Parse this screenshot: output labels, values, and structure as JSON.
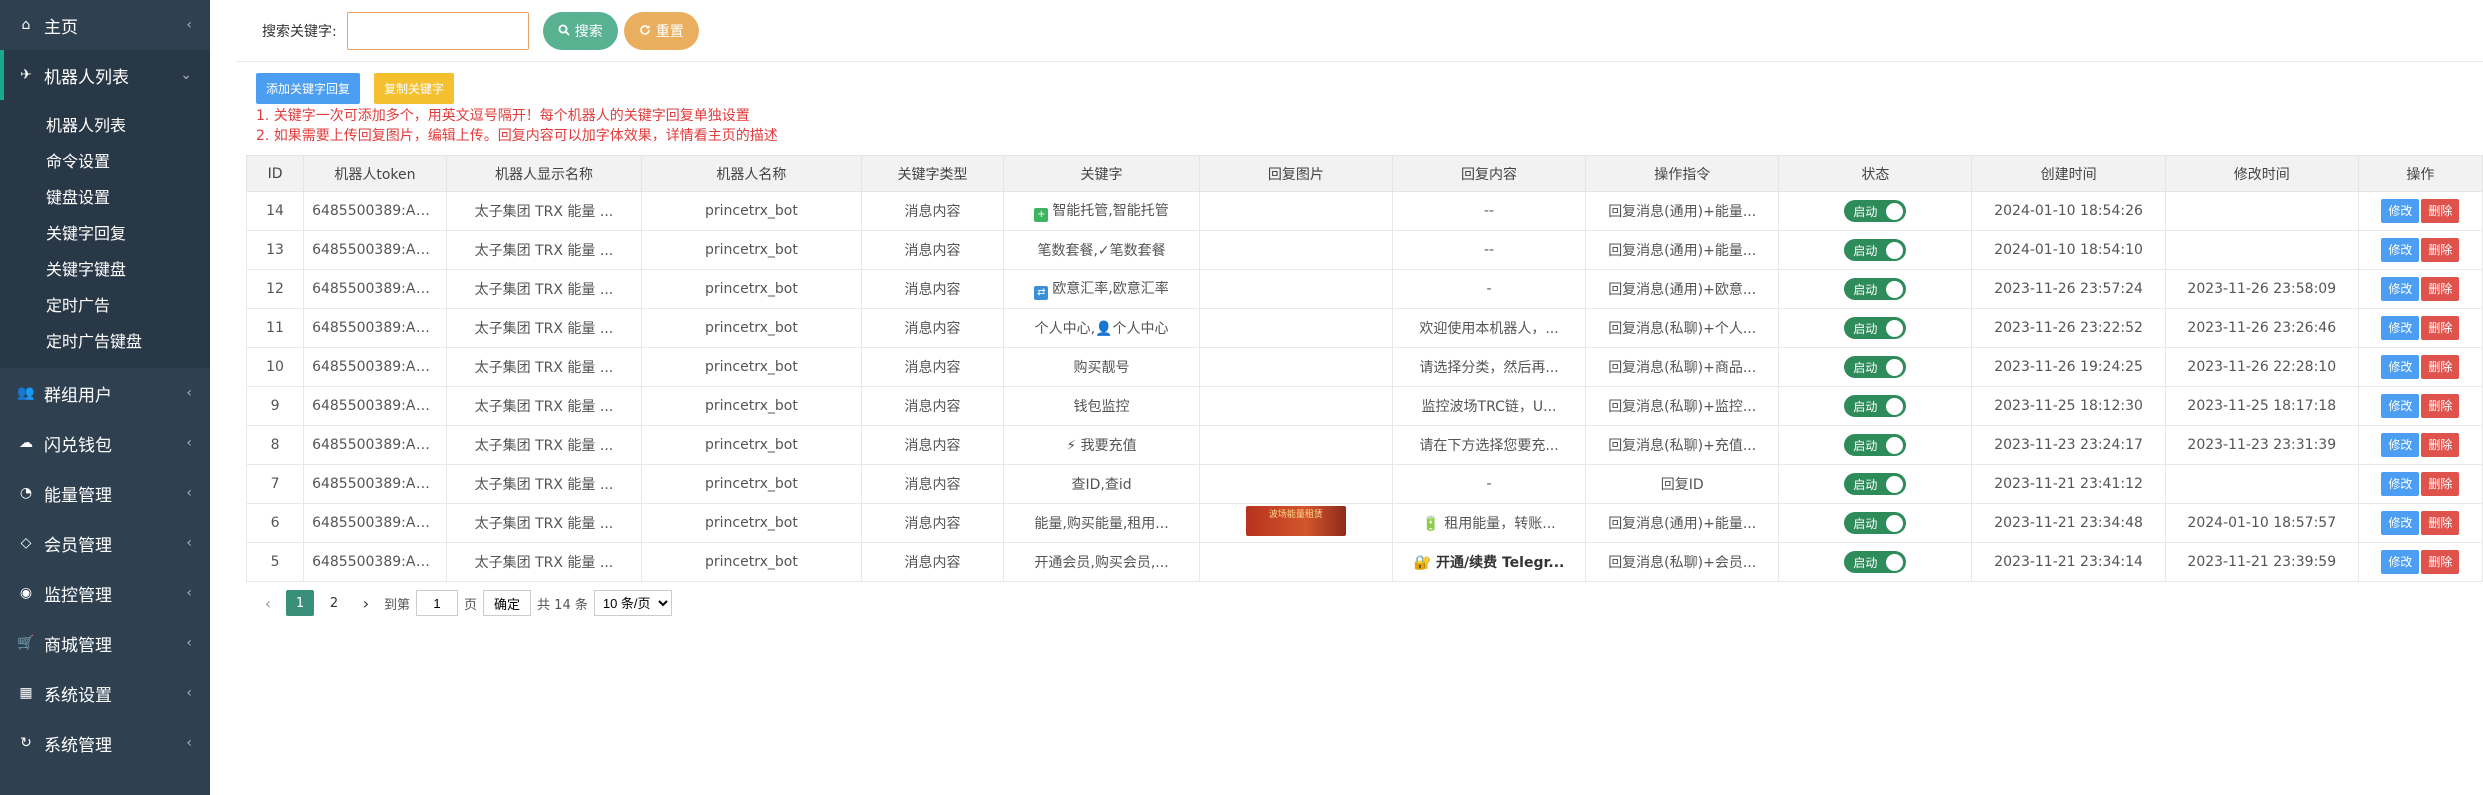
{
  "sidebar": {
    "items": [
      {
        "label": "主页",
        "icon": "home-icon"
      },
      {
        "label": "机器人列表",
        "icon": "plane-icon",
        "active": true,
        "children": [
          "机器人列表",
          "命令设置",
          "键盘设置",
          "关键字回复",
          "关键字键盘",
          "定时广告",
          "定时广告键盘"
        ]
      },
      {
        "label": "群组用户",
        "icon": "users-icon"
      },
      {
        "label": "闪兑钱包",
        "icon": "cloud-icon"
      },
      {
        "label": "能量管理",
        "icon": "gauge-icon"
      },
      {
        "label": "会员管理",
        "icon": "diamond-icon"
      },
      {
        "label": "监控管理",
        "icon": "database-icon"
      },
      {
        "label": "商城管理",
        "icon": "cart-icon"
      },
      {
        "label": "系统设置",
        "icon": "windows-icon"
      },
      {
        "label": "系统管理",
        "icon": "refresh-icon"
      }
    ]
  },
  "search": {
    "label": "搜索关键字:",
    "value": "",
    "placeholder": "",
    "search_btn": "搜索",
    "reset_btn": "重置"
  },
  "toolbar": {
    "add_btn": "添加关键字回复",
    "copy_btn": "复制关键字"
  },
  "notes": [
    "1. 关键字一次可添加多个，用英文逗号隔开！每个机器人的关键字回复单独设置",
    "2. 如果需要上传回复图片，编辑上传。回复内容可以加字体效果，详情看主页的描述"
  ],
  "table": {
    "headers": [
      "ID",
      "机器人token",
      "机器人显示名称",
      "机器人名称",
      "关键字类型",
      "关键字",
      "回复图片",
      "回复内容",
      "操作指令",
      "状态",
      "创建时间",
      "修改时间",
      "操作"
    ],
    "status_label": "启动",
    "edit_label": "修改",
    "delete_label": "删除",
    "rows": [
      {
        "id": "14",
        "token": "6485500389:AAHOc...",
        "display": "太子集团 TRX 能量 ...",
        "name": "princetrx_bot",
        "ktype": "消息内容",
        "keyword": "智能托管,智能托管",
        "kicon": "green-plus",
        "image": "",
        "reply": "--",
        "reply_bold": false,
        "cmd": "回复消息(通用)+能量...",
        "created": "2024-01-10 18:54:26",
        "modified": ""
      },
      {
        "id": "13",
        "token": "6485500389:AAHOc...",
        "display": "太子集团 TRX 能量 ...",
        "name": "princetrx_bot",
        "ktype": "消息内容",
        "keyword": "笔数套餐,✓笔数套餐",
        "kicon": "",
        "image": "",
        "reply": "--",
        "reply_bold": false,
        "cmd": "回复消息(通用)+能量...",
        "created": "2024-01-10 18:54:10",
        "modified": ""
      },
      {
        "id": "12",
        "token": "6485500389:AAHOc...",
        "display": "太子集团 TRX 能量 ...",
        "name": "princetrx_bot",
        "ktype": "消息内容",
        "keyword": "欧意汇率,欧意汇率",
        "kicon": "blue-box",
        "image": "",
        "reply": "-",
        "reply_bold": false,
        "cmd": "回复消息(通用)+欧意...",
        "created": "2023-11-26 23:57:24",
        "modified": "2023-11-26 23:58:09"
      },
      {
        "id": "11",
        "token": "6485500389:AAHOc...",
        "display": "太子集团 TRX 能量 ...",
        "name": "princetrx_bot",
        "ktype": "消息内容",
        "keyword": "个人中心,👤个人中心",
        "kicon": "",
        "image": "",
        "reply": "欢迎使用本机器人，...",
        "reply_bold": false,
        "cmd": "回复消息(私聊)+个人...",
        "created": "2023-11-26 23:22:52",
        "modified": "2023-11-26 23:26:46"
      },
      {
        "id": "10",
        "token": "6485500389:AAHOc...",
        "display": "太子集团 TRX 能量 ...",
        "name": "princetrx_bot",
        "ktype": "消息内容",
        "keyword": "购买靓号",
        "kicon": "",
        "image": "",
        "reply": "请选择分类，然后再...",
        "reply_bold": false,
        "cmd": "回复消息(私聊)+商品...",
        "created": "2023-11-26 19:24:25",
        "modified": "2023-11-26 22:28:10"
      },
      {
        "id": "9",
        "token": "6485500389:AAHOc...",
        "display": "太子集团 TRX 能量 ...",
        "name": "princetrx_bot",
        "ktype": "消息内容",
        "keyword": "钱包监控",
        "kicon": "",
        "image": "",
        "reply": "监控波场TRC链，U...",
        "reply_bold": false,
        "cmd": "回复消息(私聊)+监控...",
        "created": "2023-11-25 18:12:30",
        "modified": "2023-11-25 18:17:18"
      },
      {
        "id": "8",
        "token": "6485500389:AAHOc...",
        "display": "太子集团 TRX 能量 ...",
        "name": "princetrx_bot",
        "ktype": "消息内容",
        "keyword": "⚡ 我要充值",
        "kicon": "",
        "image": "",
        "reply": "请在下方选择您要充...",
        "reply_bold": false,
        "cmd": "回复消息(私聊)+充值...",
        "created": "2023-11-23 23:24:17",
        "modified": "2023-11-23 23:31:39"
      },
      {
        "id": "7",
        "token": "6485500389:AAHOc...",
        "display": "太子集团 TRX 能量 ...",
        "name": "princetrx_bot",
        "ktype": "消息内容",
        "keyword": "查ID,查id",
        "kicon": "",
        "image": "",
        "reply": "-",
        "reply_bold": false,
        "cmd": "回复ID",
        "created": "2023-11-21 23:41:12",
        "modified": ""
      },
      {
        "id": "6",
        "token": "6485500389:AAHOc...",
        "display": "太子集团 TRX 能量 ...",
        "name": "princetrx_bot",
        "ktype": "消息内容",
        "keyword": "能量,购买能量,租用...",
        "kicon": "",
        "image": "波场能量租赁",
        "reply": "🔋 租用能量，转账...",
        "reply_bold": false,
        "cmd": "回复消息(通用)+能量...",
        "created": "2023-11-21 23:34:48",
        "modified": "2024-01-10 18:57:57"
      },
      {
        "id": "5",
        "token": "6485500389:AAHOc...",
        "display": "太子集团 TRX 能量 ...",
        "name": "princetrx_bot",
        "ktype": "消息内容",
        "keyword": "开通会员,购买会员,...",
        "kicon": "",
        "image": "",
        "reply": "🔐 开通/续费 Telegr...",
        "reply_bold": true,
        "cmd": "回复消息(私聊)+会员...",
        "created": "2023-11-21 23:34:14",
        "modified": "2023-11-21 23:39:59"
      }
    ]
  },
  "pager": {
    "prev": "‹",
    "pages": [
      "1",
      "2"
    ],
    "next": "›",
    "goto_label": "到第",
    "goto_value": "1",
    "page_unit": "页",
    "confirm": "确定",
    "total": "共 14 条",
    "page_size": "10 条/页"
  },
  "colors": {
    "sidebar_bg": "#2f4050",
    "accent": "#19aa8d",
    "search_btn": "#58b191",
    "reset_btn": "#eaae5f",
    "note_red": "#e23b3b"
  }
}
